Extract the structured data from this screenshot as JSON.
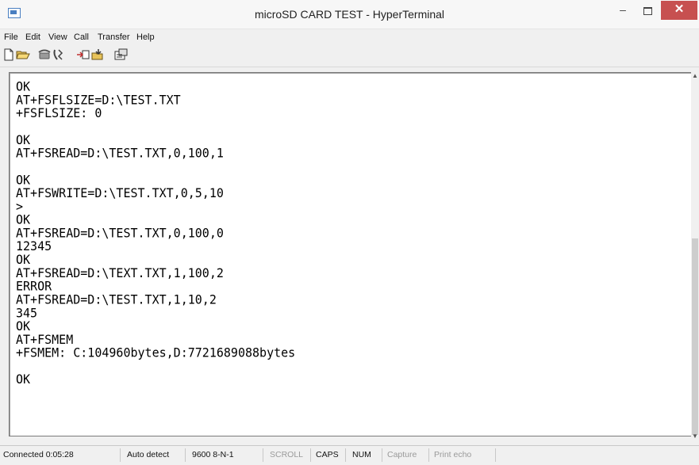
{
  "window": {
    "title": "microSD CARD TEST - HyperTerminal",
    "min_label": "–",
    "close_label": "✕",
    "accent_close": "#c75050"
  },
  "menu": {
    "items": [
      "File",
      "Edit",
      "View",
      "Call",
      "Transfer",
      "Help"
    ]
  },
  "toolbar": {
    "icons": [
      "new-document-icon",
      "open-folder-icon",
      "connect-phone-icon",
      "disconnect-phone-icon",
      "send-file-icon",
      "receive-file-icon",
      "properties-icon"
    ]
  },
  "terminal": {
    "text": "OK\nAT+FSFLSIZE=D:\\TEST.TXT\n+FSFLSIZE: 0\n\nOK\nAT+FSREAD=D:\\TEST.TXT,0,100,1\n\nOK\nAT+FSWRITE=D:\\TEST.TXT,0,5,10\n>\nOK\nAT+FSREAD=D:\\TEST.TXT,0,100,0\n12345\nOK\nAT+FSREAD=D:\\TEXT.TXT,1,100,2\nERROR\nAT+FSREAD=D:\\TEST.TXT,1,10,2\n345\nOK\nAT+FSMEM\n+FSMEM: C:104960bytes,D:7721689088bytes\n\nOK"
  },
  "status": {
    "connected": "Connected 0:05:28",
    "detect": "Auto detect",
    "port": "9600 8-N-1",
    "scroll": "SCROLL",
    "caps": "CAPS",
    "num": "NUM",
    "capture": "Capture",
    "print_echo": "Print echo"
  }
}
